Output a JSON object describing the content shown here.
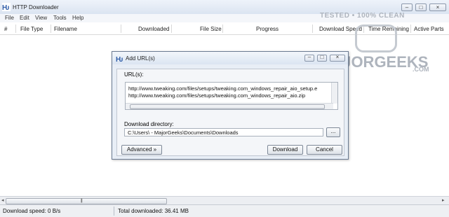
{
  "app": {
    "title": "HTTP Downloader",
    "window_buttons": [
      "–",
      "□",
      "×"
    ],
    "menu": [
      "File",
      "Edit",
      "View",
      "Tools",
      "Help"
    ],
    "columns": [
      "#",
      "File Type",
      "Filename",
      "Downloaded",
      "File Size",
      "Progress",
      "Download Speed",
      "Time Remaining",
      "Active Parts"
    ],
    "status": {
      "download_speed": "Download speed:  0 B/s",
      "total_downloaded": "Total downloaded:  36.41 MB"
    }
  },
  "watermark": {
    "top_text": "TESTED • 100% CLEAN",
    "main_text": "MAJORGEEKS",
    "com_text": ".COM"
  },
  "dialog": {
    "title": "Add URL(s)",
    "window_buttons": [
      "–",
      "□",
      "×"
    ],
    "urls_label": "URL(s):",
    "urls": [
      "http://www.tweaking.com/files/setups/tweaking.com_windows_repair_aio_setup.e",
      "http://www.tweaking.com/files/setups/tweaking.com_windows_repair_aio.zip"
    ],
    "download_dir_label": "Download directory:",
    "download_dir": "C:\\Users\\      - MajorGeeks\\Documents\\Downloads",
    "browse_label": "...",
    "advanced_label": "Advanced »",
    "download_label": "Download",
    "cancel_label": "Cancel"
  },
  "colors": {
    "accent": "#2f5da8",
    "titlebar": "#dbe4f1"
  }
}
